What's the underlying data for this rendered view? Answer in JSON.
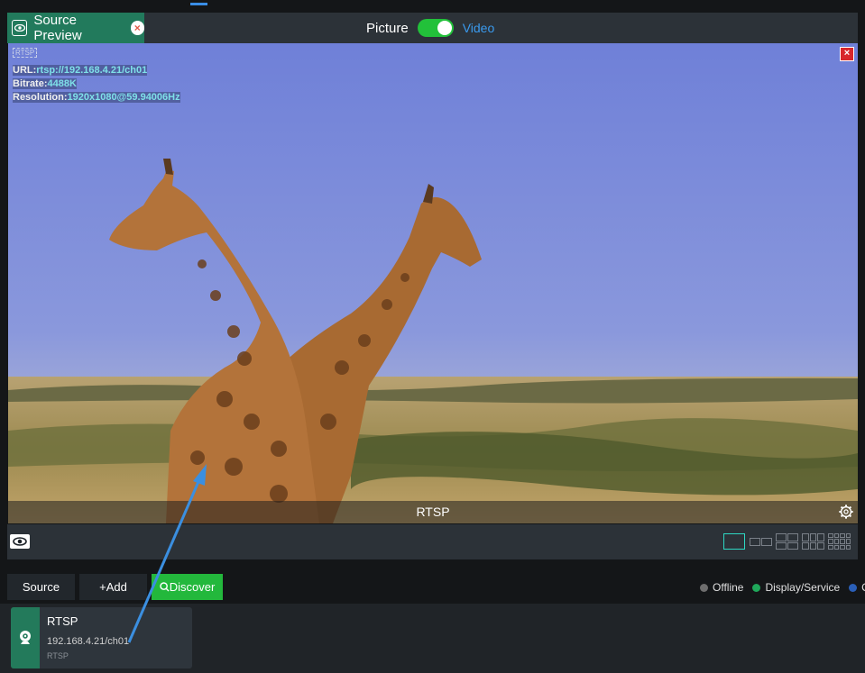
{
  "header": {
    "source_preview_title": "Source Preview",
    "picture_label": "Picture",
    "video_label": "Video",
    "toggle_on": true
  },
  "preview": {
    "tag": "RTSP",
    "url_key": "URL:",
    "url_value": "rtsp://192.168.4.21/ch01",
    "bitrate_key": "Bitrate:",
    "bitrate_value": "4488K",
    "resolution_key": "Resolution:",
    "resolution_value": "1920x1080@59.94006Hz",
    "caption": "RTSP",
    "close_icon": "close-icon",
    "settings_icon": "gear-icon"
  },
  "toolbar": {
    "layouts": [
      "1x1",
      "1x2",
      "2x2",
      "2x3",
      "3x4"
    ]
  },
  "actions": {
    "source_label": "Source",
    "add_label": "+Add",
    "discover_label": "Discover"
  },
  "legend": [
    {
      "label": "Offline",
      "color": "#6e6e6e"
    },
    {
      "label": "Display/Service",
      "color": "#1fa85a"
    },
    {
      "label": "C",
      "color": "#2a5fb8"
    }
  ],
  "sources": [
    {
      "name": "RTSP",
      "address": "192.168.4.21/ch01",
      "protocol": "RTSP",
      "icon": "webcam-icon"
    }
  ],
  "colors": {
    "accent_green": "#227a5c",
    "toggle_green": "#22c13a",
    "link_blue": "#3a9aee",
    "close_red": "#d8262b"
  }
}
